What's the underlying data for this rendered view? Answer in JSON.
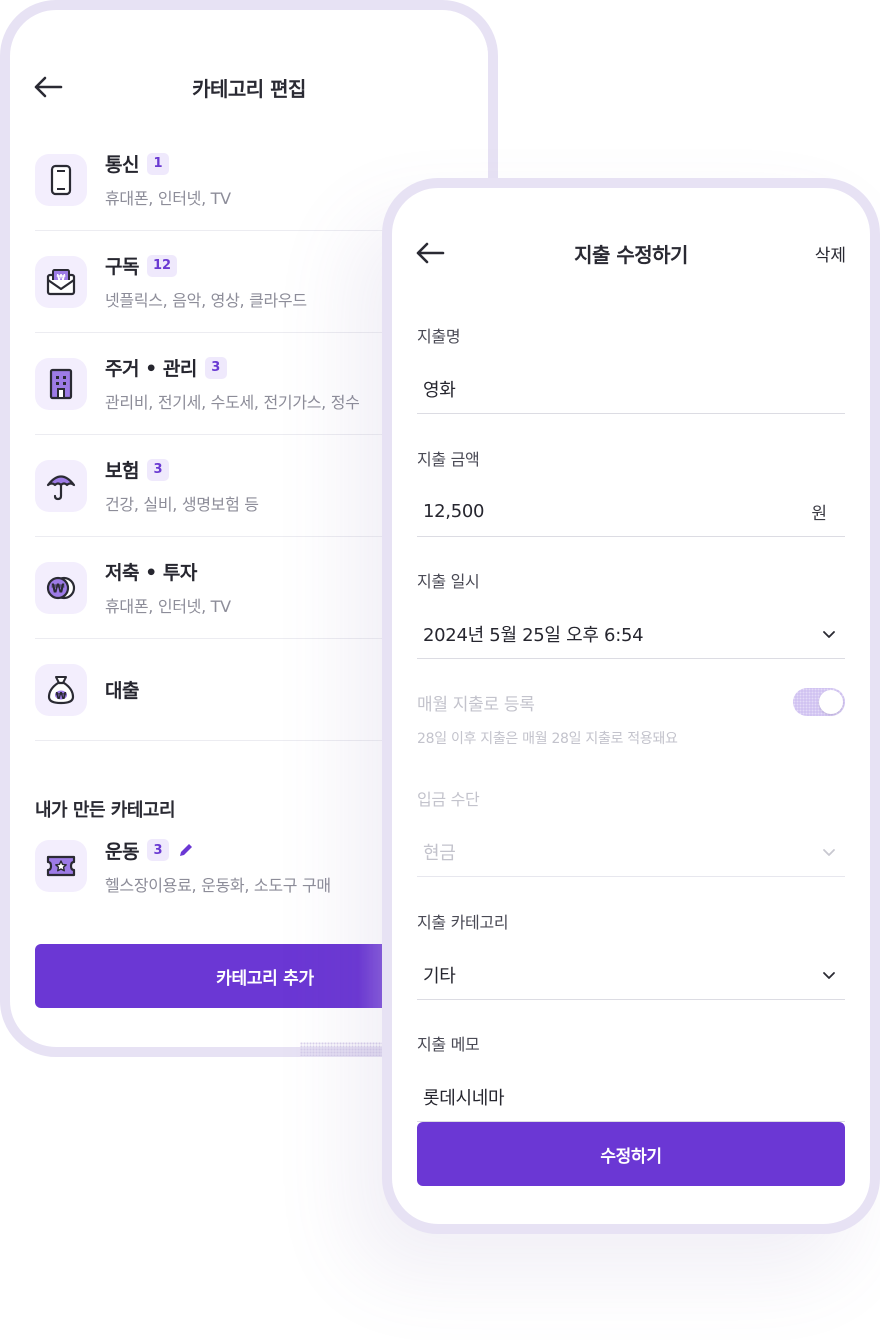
{
  "colors": {
    "primary": "#6b37d4",
    "icon_bg": "#f3eefd",
    "badge_bg": "#efe9fc",
    "frame": "#e7e2f4"
  },
  "left": {
    "title": "카테고리 편집",
    "categories": [
      {
        "name": "통신",
        "count": "1",
        "desc": "휴대폰, 인터넷, TV",
        "icon": "phone-icon"
      },
      {
        "name": "구독",
        "count": "12",
        "desc": "넷플릭스, 음악, 영상, 클라우드",
        "icon": "envelope-won-icon"
      },
      {
        "name": "주거 • 관리",
        "count": "3",
        "desc": "관리비, 전기세, 수도세, 전기가스, 정수",
        "icon": "building-icon"
      },
      {
        "name": "보험",
        "count": "3",
        "desc": "건강, 실비, 생명보험 등",
        "icon": "umbrella-icon"
      },
      {
        "name": "저축 • 투자",
        "desc": "휴대폰, 인터넷, TV",
        "icon": "coins-won-icon"
      },
      {
        "name": "대출",
        "icon": "money-bag-icon"
      }
    ],
    "my_section_title": "내가 만든 카테고리",
    "my_categories": [
      {
        "name": "운동",
        "count": "3",
        "desc": "헬스장이용료, 운동화, 소도구 구매",
        "icon": "ticket-icon"
      }
    ],
    "add_button": "카테고리 추가"
  },
  "right": {
    "title": "지출 수정하기",
    "delete_label": "삭제",
    "fields": {
      "name": {
        "label": "지출명",
        "value": "영화"
      },
      "amount": {
        "label": "지출 금액",
        "value": "12,500",
        "unit": "원"
      },
      "datetime": {
        "label": "지출 일시",
        "value": "2024년 5월 25일 오후 6:54"
      },
      "monthly": {
        "label": "매월 지출로 등록",
        "help": "28일 이후 지출은 매월 28일 지출로 적용돼요"
      },
      "payment": {
        "label": "입금 수단",
        "value": "현금"
      },
      "category": {
        "label": "지출 카테고리",
        "value": "기타"
      },
      "memo": {
        "label": "지출 메모",
        "value": "롯데시네마"
      }
    },
    "submit_button": "수정하기"
  }
}
